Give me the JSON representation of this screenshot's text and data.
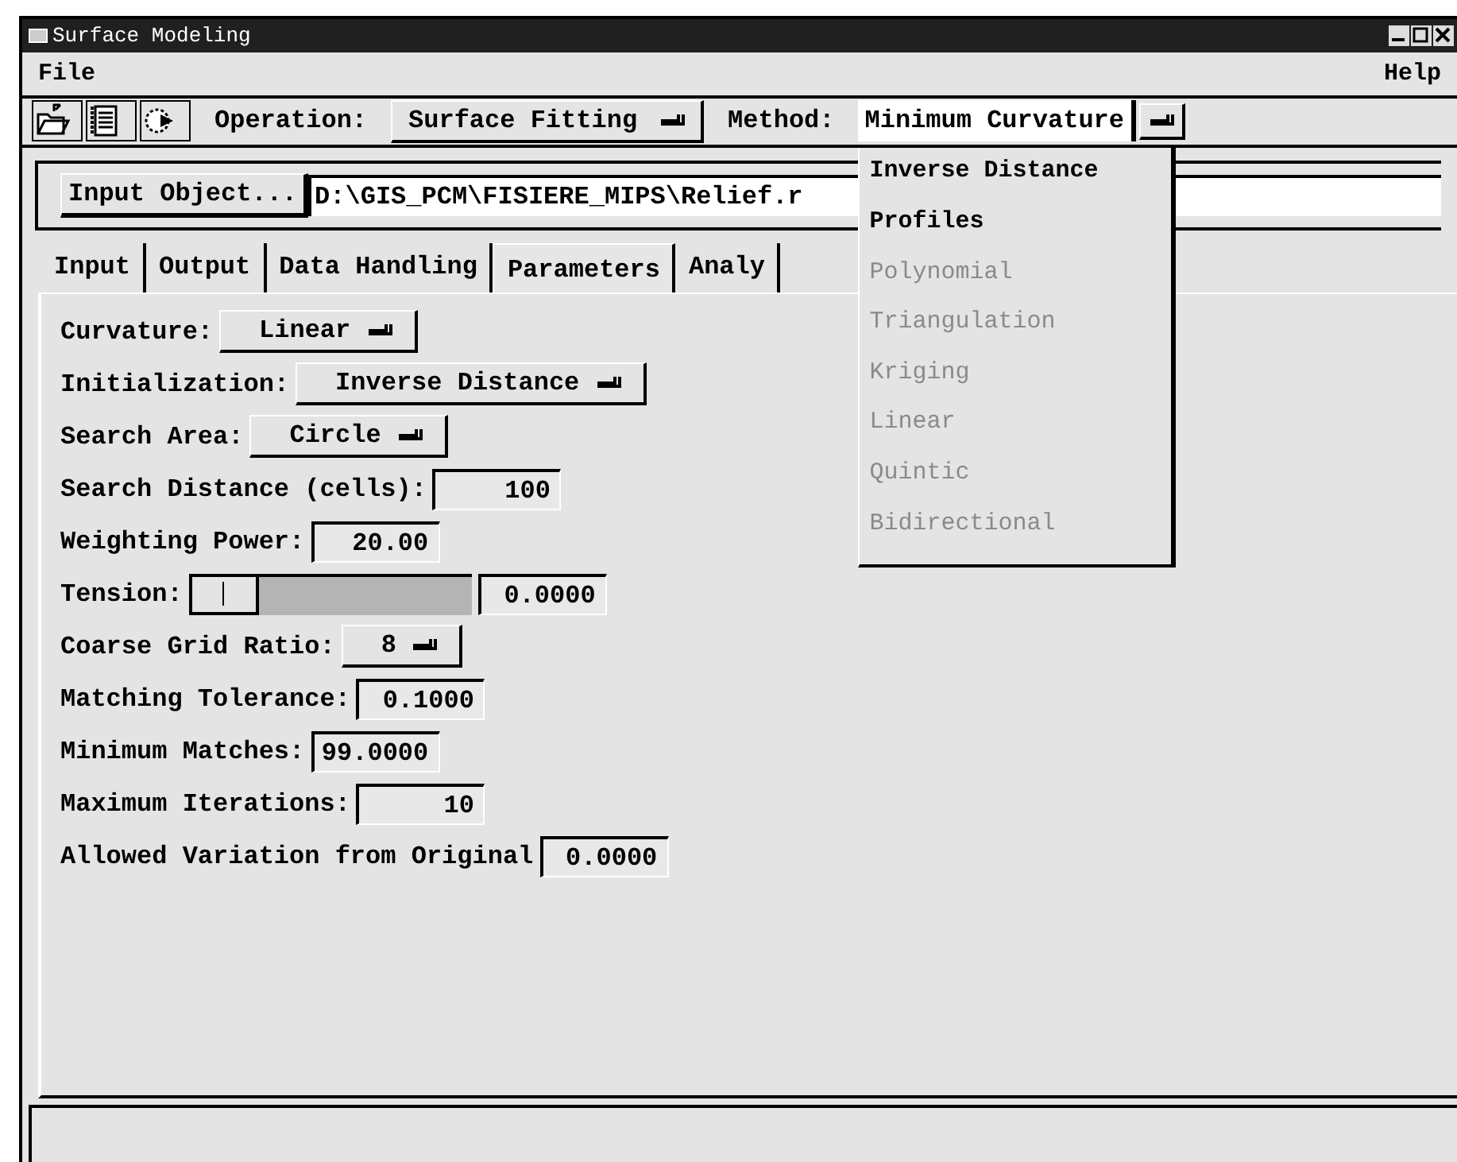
{
  "window": {
    "title": "Surface Modeling"
  },
  "menu_bar": [
    "File",
    "Help"
  ],
  "toolbar": {
    "operation": {
      "label": "Operation:",
      "value": "Surface Fitting"
    },
    "method": {
      "label": "Method:",
      "value": "Minimum Curvature"
    }
  },
  "input_object": {
    "button": "Input Object...",
    "value": "D:\\GIS_PCM\\FISIERE_MIPS\\Relief.r"
  },
  "tabs": [
    {
      "label": "Input",
      "selected": false
    },
    {
      "label": "Output",
      "selected": false
    },
    {
      "label": "Data Handling",
      "selected": false
    },
    {
      "label": "Parameters",
      "selected": true
    },
    {
      "label": "Analy",
      "selected": false
    }
  ],
  "parameters": [
    {
      "kind": "option",
      "label": "Curvature:",
      "value": "Linear"
    },
    {
      "kind": "option",
      "label": "Initialization:",
      "value": "Inverse Distance"
    },
    {
      "kind": "option",
      "label": "Search Area:",
      "value": "Circle"
    },
    {
      "kind": "field",
      "label": "Search Distance (cells):",
      "value": "100"
    },
    {
      "kind": "field",
      "label": "Weighting Power:",
      "value": "20.00"
    },
    {
      "kind": "slider",
      "label": "Tension:",
      "level": 0,
      "value": "0.0000"
    },
    {
      "kind": "option",
      "label": "Coarse Grid Ratio:",
      "value": "8"
    },
    {
      "kind": "field",
      "label": "Matching Tolerance:",
      "value": "0.1000"
    },
    {
      "kind": "field",
      "label": "Minimum Matches:",
      "value": "99.0000"
    },
    {
      "kind": "field",
      "label": "Maximum Iterations:",
      "value": "10"
    },
    {
      "kind": "field",
      "label": "Allowed Variation from Original",
      "value": "0.0000"
    }
  ],
  "method_menu": [
    {
      "label": "Inverse Distance",
      "disabled": false
    },
    {
      "label": "Profiles",
      "disabled": false
    },
    {
      "label": "Polynomial",
      "disabled": true
    },
    {
      "label": "Triangulation",
      "disabled": true
    },
    {
      "label": "Kriging",
      "disabled": true
    },
    {
      "label": "Linear",
      "disabled": true
    },
    {
      "label": "Quintic",
      "disabled": true
    },
    {
      "label": "Bidirectional",
      "disabled": true
    }
  ]
}
